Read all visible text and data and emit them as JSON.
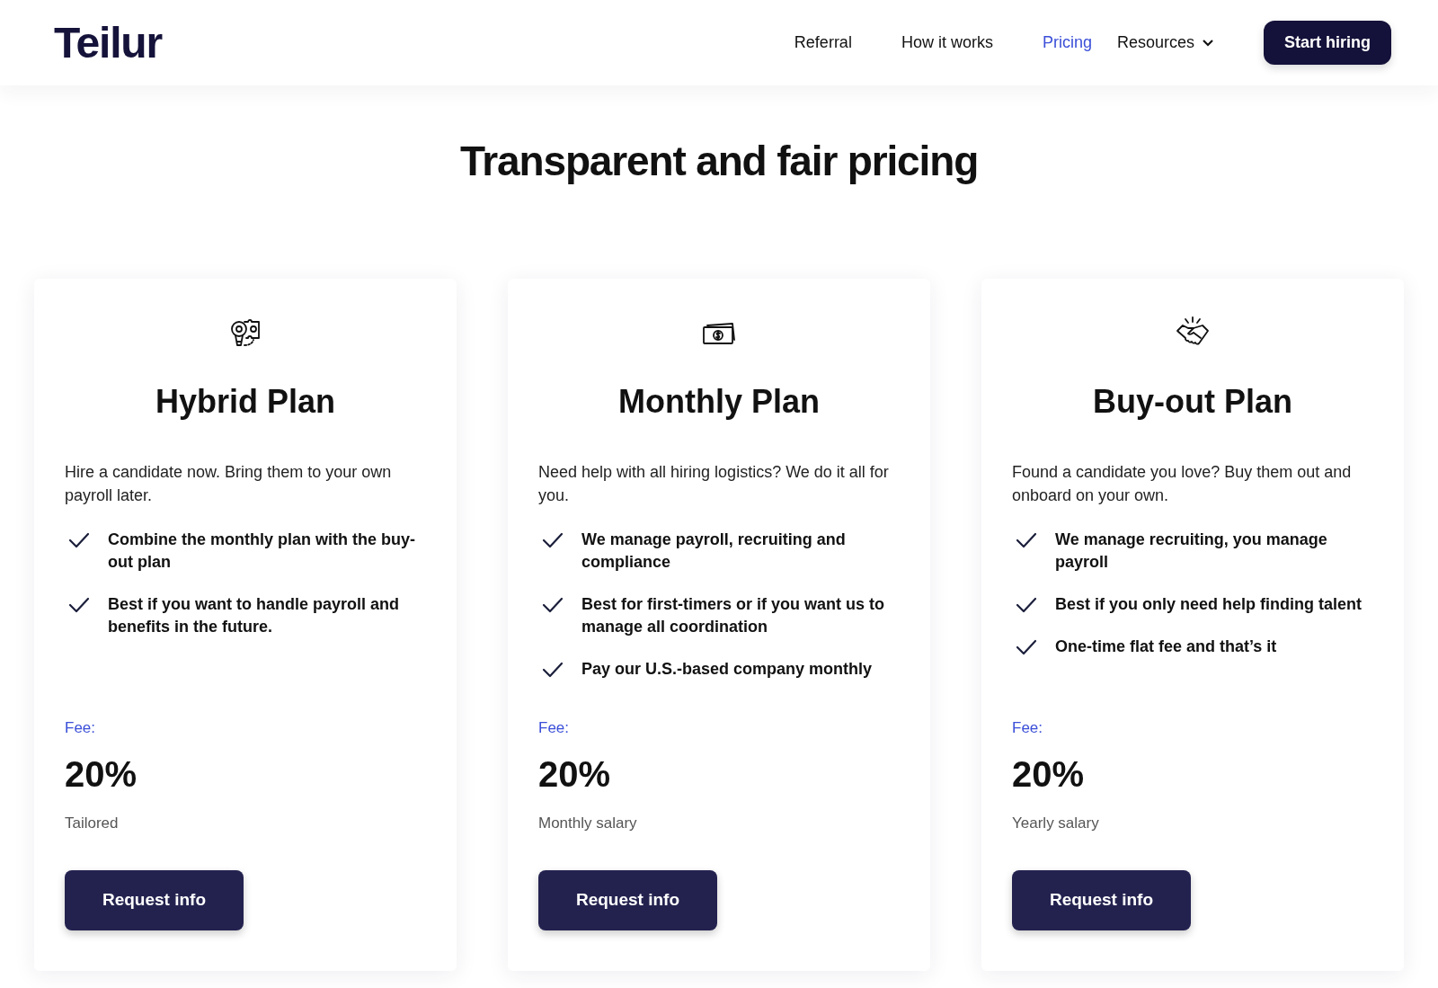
{
  "header": {
    "logo": "Teilur",
    "nav": [
      {
        "label": "Referral",
        "selected": false
      },
      {
        "label": "How it works",
        "selected": false
      },
      {
        "label": "Pricing",
        "selected": true
      },
      {
        "label": "Resources",
        "selected": false,
        "dropdown": true
      }
    ],
    "cta": "Start hiring"
  },
  "heading": "Transparent and fair pricing",
  "plans": [
    {
      "title": "Hybrid Plan",
      "description": "Hire a candidate now. Bring them to your own payroll later.",
      "features": [
        "Combine the monthly plan with the buy-out plan",
        "Best if you want to handle payroll and benefits in the future."
      ],
      "fee_label": "Fee:",
      "fee": "20%",
      "fee_note": "Tailored",
      "button": "Request info"
    },
    {
      "title": "Monthly Plan",
      "description": "Need help with all hiring logistics? We do it all for you.",
      "features": [
        "We manage payroll, recruiting and compliance",
        "Best for first-timers or if you want us to manage all coordination",
        "Pay our U.S.-based company monthly"
      ],
      "fee_label": "Fee:",
      "fee": "20%",
      "fee_note": "Monthly salary",
      "button": "Request info"
    },
    {
      "title": "Buy-out Plan",
      "description": "Found a candidate you love? Buy them out and onboard on your own.",
      "features": [
        "We manage recruiting, you manage payroll",
        "Best if you only need help finding talent",
        "One-time flat fee and that’s it"
      ],
      "fee_label": "Fee:",
      "fee": "20%",
      "fee_note": "Yearly salary",
      "button": "Request info"
    }
  ]
}
